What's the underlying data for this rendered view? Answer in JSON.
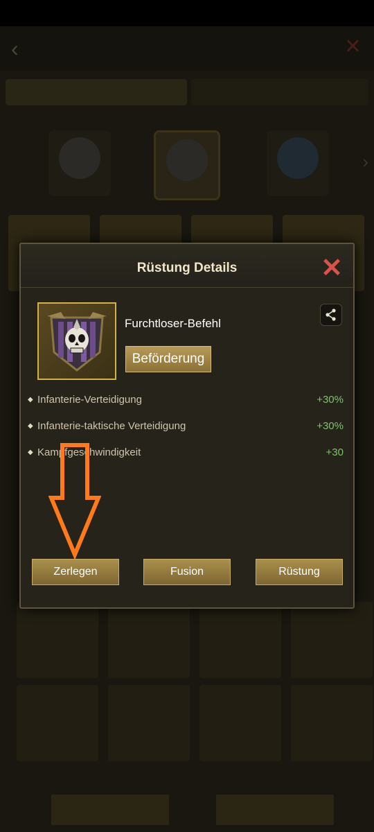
{
  "colors": {
    "gold_border": "#d4b24a",
    "button_gold": "#aa8f4c",
    "stat_green": "#7ec46b",
    "close_red": "#d9534a",
    "annotation_orange": "#ff7a1a"
  },
  "modal": {
    "title": "Rüstung Details",
    "close_icon": "close-x-icon",
    "item": {
      "name": "Furchtloser-Befehl",
      "icon": "skull-shield-icon",
      "promote_label": "Beförderung",
      "share_icon": "share-icon"
    },
    "stats": [
      {
        "name": "Infanterie-Verteidigung",
        "value": "+30%"
      },
      {
        "name": "Infanterie-taktische Verteidigung",
        "value": "+30%"
      },
      {
        "name": "Kampfgeschwindigkeit",
        "value": "+30"
      }
    ],
    "buttons": {
      "disassemble": "Zerlegen",
      "fusion": "Fusion",
      "armor": "Rüstung"
    }
  }
}
